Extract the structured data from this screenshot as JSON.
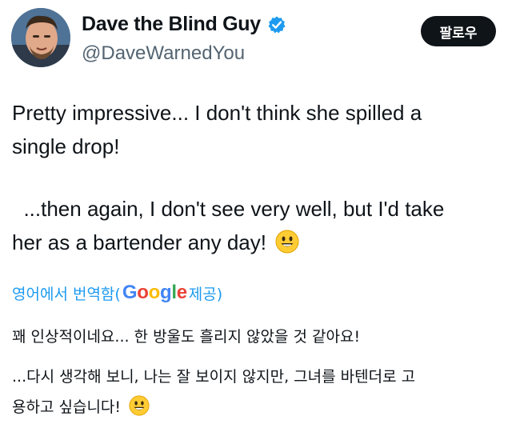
{
  "profile": {
    "display_name": "Dave the Blind Guy",
    "handle": "@DaveWarnedYou",
    "verified_icon": "verified-badge-icon",
    "follow_label": "팔로우",
    "accent": "#1d9bf0"
  },
  "tweet": {
    "paragraph1_line1": "Pretty impressive... I don't think she spilled a",
    "paragraph1_line2": "single drop!",
    "paragraph2_line1": "  ...then again, I don't see very well, but I'd take",
    "paragraph2_line2": "her as a bartender any day!",
    "emoji": "smiley-face-icon"
  },
  "translation": {
    "prefix": "영어에서 번역함(",
    "provider": "Google",
    "suffix": " 제공)",
    "line1": "꽤 인상적이네요... 한 방울도 흘리지 않았을 것 같아요!",
    "line2": "...다시 생각해 보니, 나는 잘 보이지 않지만, 그녀를 바텐더로 고",
    "line3": "용하고 싶습니다!"
  }
}
